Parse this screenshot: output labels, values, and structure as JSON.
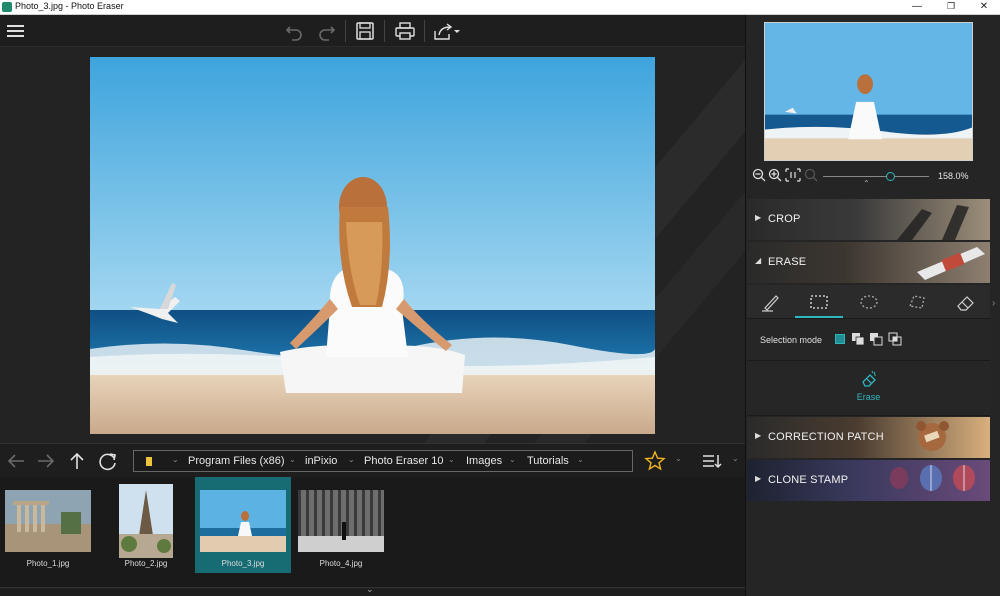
{
  "window": {
    "title": "Photo_3.jpg - Photo Eraser",
    "minimize": "—",
    "restore": "❐",
    "close": "✕"
  },
  "navigation": {
    "breadcrumbs": [
      "Program Files (x86)",
      "inPixio",
      "Photo Eraser 10",
      "Images",
      "Tutorials"
    ]
  },
  "filmstrip": {
    "thumbnails": [
      {
        "caption": "Photo_1.jpg",
        "selected": false
      },
      {
        "caption": "Photo_2.jpg",
        "selected": false
      },
      {
        "caption": "Photo_3.jpg",
        "selected": true
      },
      {
        "caption": "Photo_4.jpg",
        "selected": false
      }
    ]
  },
  "zoom": {
    "value": "158.0%",
    "level": 0.63
  },
  "panels": {
    "crop": "CROP",
    "erase": "ERASE",
    "correction_patch": "CORRECTION PATCH",
    "clone_stamp": "CLONE STAMP"
  },
  "erase_panel": {
    "selection_mode_label": "Selection mode",
    "erase_button": "Erase"
  },
  "colors": {
    "accent": "#2fb7bf",
    "selected_thumb": "#176b73",
    "background": "#232323"
  }
}
